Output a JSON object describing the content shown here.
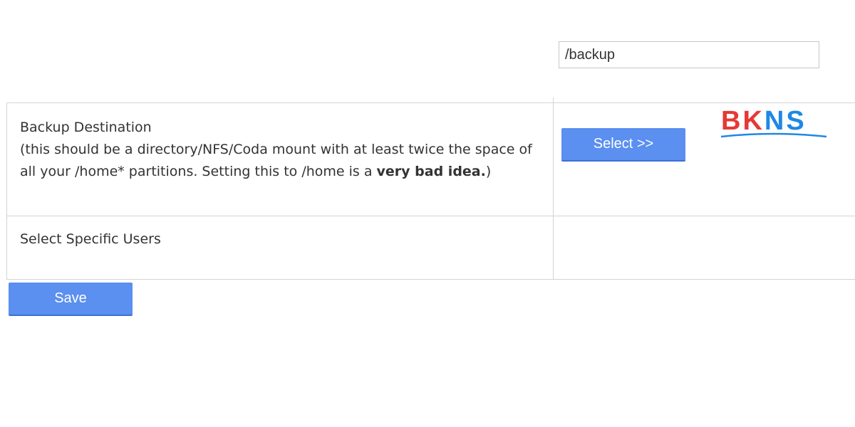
{
  "logo": {
    "text_part1": "BK",
    "text_part2": "NS",
    "colors": {
      "red": "#e53935",
      "blue": "#1e88e5"
    }
  },
  "backup_destination": {
    "title": "Backup Destination",
    "description_plain": "(this should be a directory/NFS/Coda mount with at least twice the space of all your /home* partitions. Setting this to /home is a ",
    "description_bold": "very bad idea.",
    "description_end": ")",
    "input_value": "/backup"
  },
  "select_users": {
    "label": "Select Specific Users",
    "button_label": "Select >>"
  },
  "footer": {
    "save_label": "Save"
  },
  "colors": {
    "button": "#5b8ff0",
    "border": "#d4d4d4",
    "text": "#333333"
  }
}
